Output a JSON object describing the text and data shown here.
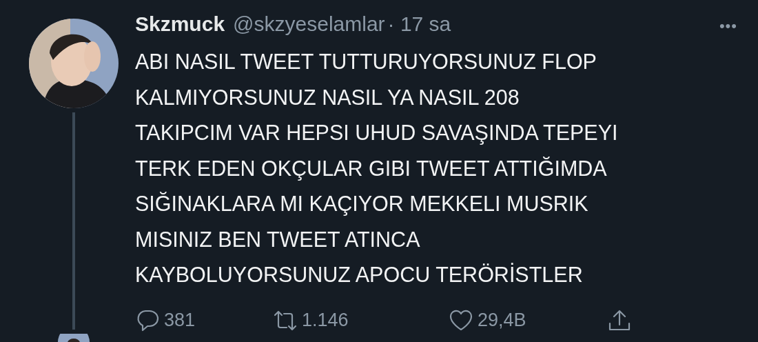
{
  "tweet": {
    "name": "Skzmuck",
    "handle": "@skzyeselamlar",
    "time": "· 17 sa",
    "more": "•••",
    "lines": [
      "ABI NASIL TWEET TUTTURUYORSUNUZ FLOP",
      "KALMIYORSUNUZ NASIL YA NASIL 208",
      "TAKIPCIM VAR HEPSI UHUD SAVAŞINDA TEPEYI",
      "TERK EDEN OKÇULAR GIBI TWEET ATTIĞIMDA",
      "SIĞINAKLARA MI KAÇIYOR MEKKELI MUSRIK",
      "MISINIZ BEN TWEET ATINCA",
      "KAYBOLUYORSUNUZ APOCU TERÖRİSTLER"
    ],
    "actions": [
      {
        "kind": "reply",
        "count": "381"
      },
      {
        "kind": "retweet",
        "count": "1.146"
      },
      {
        "kind": "like",
        "count": "29,4B"
      },
      {
        "kind": "share"
      }
    ]
  }
}
